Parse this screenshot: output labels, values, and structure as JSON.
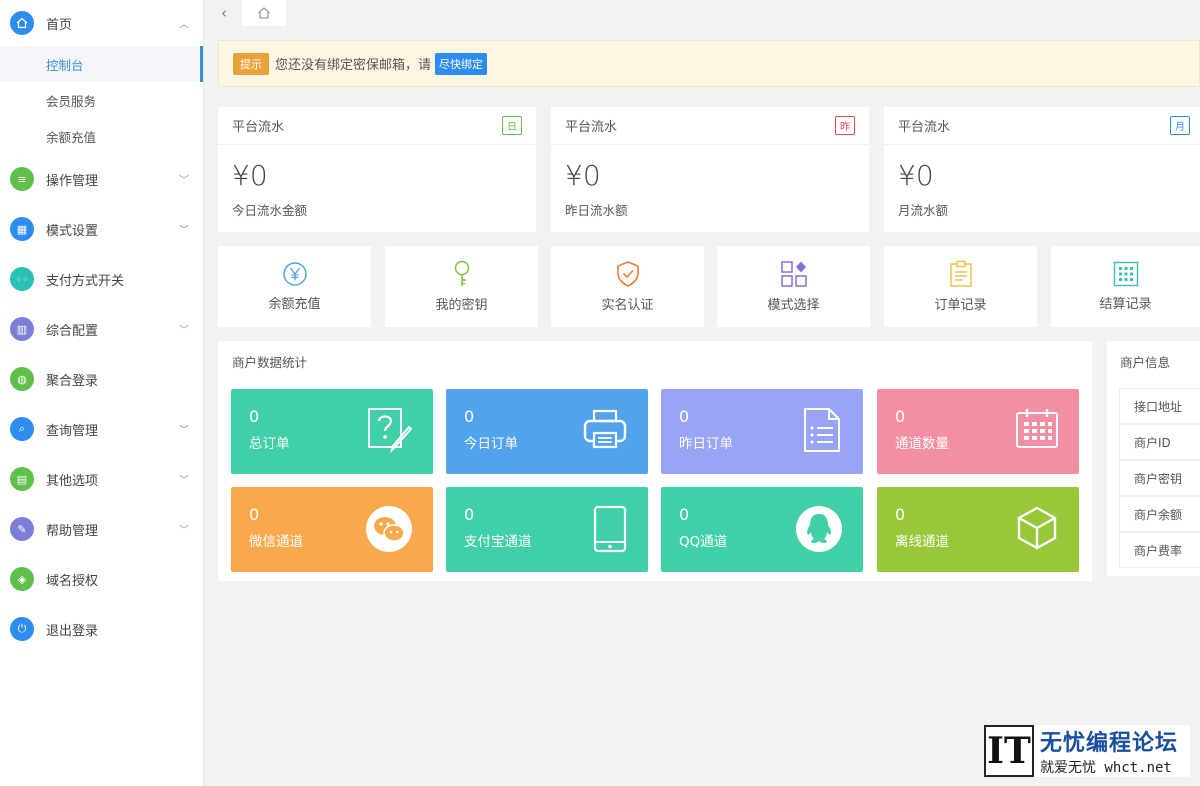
{
  "sidebar": {
    "home": {
      "label": "首页",
      "icon": "home-icon"
    },
    "sub": [
      "控制台",
      "会员服务",
      "余额充值"
    ],
    "items": [
      {
        "label": "操作管理",
        "icon": "list-icon",
        "color": "#5fbf4a",
        "arrow": true
      },
      {
        "label": "模式设置",
        "icon": "mode-icon",
        "color": "#2d8cf0",
        "arrow": true
      },
      {
        "label": "支付方式开关",
        "icon": "toggle-icon",
        "color": "#2bc0b4",
        "arrow": false
      },
      {
        "label": "综合配置",
        "icon": "config-icon",
        "color": "#7b7fd6",
        "arrow": true
      },
      {
        "label": "聚合登录",
        "icon": "login-icon",
        "color": "#5fbf4a",
        "arrow": false
      },
      {
        "label": "查询管理",
        "icon": "search-icon",
        "color": "#2d8cf0",
        "arrow": true
      },
      {
        "label": "其他选项",
        "icon": "other-icon",
        "color": "#5fbf4a",
        "arrow": true
      },
      {
        "label": "帮助管理",
        "icon": "help-icon",
        "color": "#7b7fd6",
        "arrow": true
      },
      {
        "label": "域名授权",
        "icon": "shield-icon",
        "color": "#5fbf4a",
        "arrow": false
      },
      {
        "label": "退出登录",
        "icon": "power-icon",
        "color": "#2d8cf0",
        "arrow": false
      }
    ]
  },
  "notice": {
    "tag": "提示",
    "text": "您还没有绑定密保邮箱，请",
    "action": "尽快绑定"
  },
  "stats": [
    {
      "title": "平台流水",
      "badge": "日",
      "badge_color": "#5fbf4a",
      "amount": "¥0",
      "label": "今日流水金额"
    },
    {
      "title": "平台流水",
      "badge": "昨",
      "badge_color": "#e64b4b",
      "amount": "¥0",
      "label": "昨日流水额"
    },
    {
      "title": "平台流水",
      "badge": "月",
      "badge_color": "#2d8cf0",
      "amount": "¥0",
      "label": "月流水额"
    }
  ],
  "quick_links": [
    {
      "label": "余额充值",
      "icon": "yen-icon"
    },
    {
      "label": "我的密钥",
      "icon": "key-icon"
    },
    {
      "label": "实名认证",
      "icon": "shield-check-icon"
    },
    {
      "label": "模式选择",
      "icon": "grid-icon"
    },
    {
      "label": "订单记录",
      "icon": "clipboard-icon"
    },
    {
      "label": "结算记录",
      "icon": "calc-icon"
    }
  ],
  "merchant": {
    "title": "商户数据统计",
    "tiles": [
      {
        "value": "0",
        "label": "总订单",
        "color": "#41cfa8",
        "icon": "question-doc-icon"
      },
      {
        "value": "0",
        "label": "今日订单",
        "color": "#51a3ec",
        "icon": "printer-icon"
      },
      {
        "value": "0",
        "label": "昨日订单",
        "color": "#9aa4f5",
        "icon": "document-icon"
      },
      {
        "value": "0",
        "label": "通道数量",
        "color": "#f38fa2",
        "icon": "calendar-icon"
      },
      {
        "value": "0",
        "label": "微信通道",
        "color": "#f9a94d",
        "icon": "wechat-icon"
      },
      {
        "value": "0",
        "label": "支付宝通道",
        "color": "#41cfa8",
        "icon": "tablet-icon"
      },
      {
        "value": "0",
        "label": "QQ通道",
        "color": "#41cfa8",
        "icon": "qq-icon"
      },
      {
        "value": "0",
        "label": "离线通道",
        "color": "#98c83a",
        "icon": "cube-icon"
      }
    ]
  },
  "info": {
    "title": "商户信息",
    "rows": [
      "接口地址",
      "商户ID",
      "商户密钥",
      "商户余额",
      "商户费率"
    ]
  },
  "watermark": {
    "logo": "IT",
    "name": "无忧编程论坛",
    "sub": "就爱无忧 whct.net"
  }
}
